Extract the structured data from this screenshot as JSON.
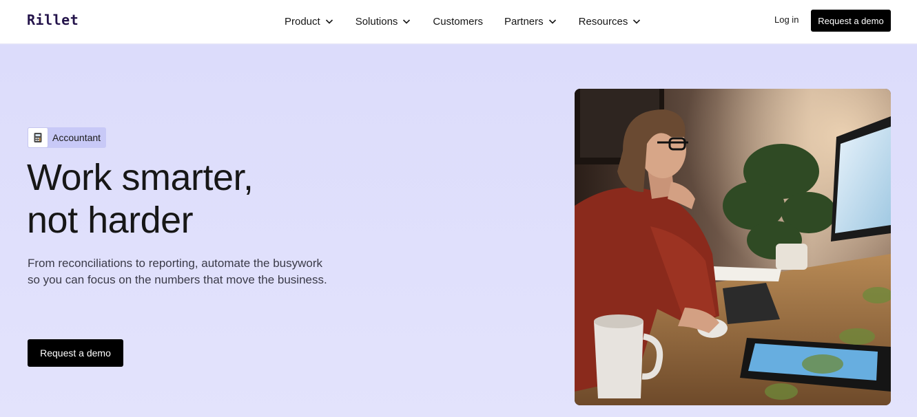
{
  "brand": {
    "logo_text": "Rillet"
  },
  "nav": {
    "items": [
      {
        "label": "Product",
        "has_dropdown": true
      },
      {
        "label": "Solutions",
        "has_dropdown": true
      },
      {
        "label": "Customers",
        "has_dropdown": false
      },
      {
        "label": "Partners",
        "has_dropdown": true
      },
      {
        "label": "Resources",
        "has_dropdown": true
      }
    ],
    "login_label": "Log in",
    "demo_label": "Request a demo"
  },
  "hero": {
    "badge": {
      "icon": "calculator-icon",
      "label": "Accountant"
    },
    "headline_line1": "Work smarter,",
    "headline_line2": "not harder",
    "subhead_line1": "From reconciliations to reporting, automate the busywork",
    "subhead_line2": "so you can focus on the numbers that move the business.",
    "cta_label": "Request a demo",
    "image": "woman-at-desk-with-computer-photo"
  },
  "colors": {
    "hero_bg": "#dcdcfb",
    "badge_bg": "#c8c9f7",
    "button_bg": "#000000",
    "logo": "#23134a"
  }
}
